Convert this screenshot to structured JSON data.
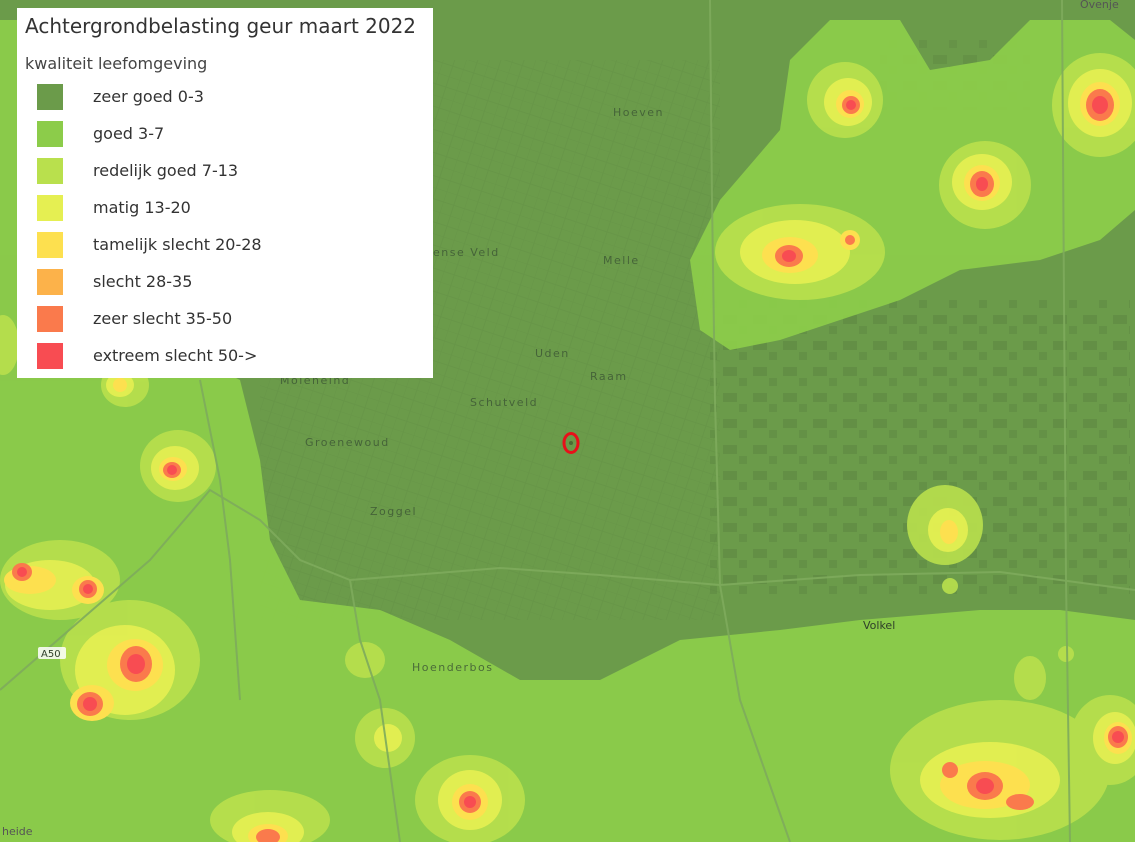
{
  "map": {
    "title": "Achtergrondbelasting geur maart 2022",
    "subtitle": "kwaliteit leefomgeving",
    "legend": [
      {
        "label": "zeer goed 0-3",
        "color": "#6b9b4a"
      },
      {
        "label": "goed 3-7",
        "color": "#8ccc4a"
      },
      {
        "label": "redelijk goed 7-13",
        "color": "#b9e04d"
      },
      {
        "label": "matig 13-20",
        "color": "#e5ef52"
      },
      {
        "label": "tamelijk slecht 20-28",
        "color": "#fde04f"
      },
      {
        "label": "slecht 28-35",
        "color": "#fcb24a"
      },
      {
        "label": "zeer slecht 35-50",
        "color": "#fa7a4c"
      },
      {
        "label": "extreem slecht 50->",
        "color": "#f84c52"
      }
    ],
    "place_labels": {
      "hoeven": "Hoeven",
      "velde": "ense Veld",
      "melle": "Melle",
      "uden": "Uden",
      "raam": "Raam",
      "schutveld": "Schutveld",
      "groenewoud": "Groenewoud",
      "zoggel": "Zoggel",
      "volkel": "Volkel",
      "hoenderbos": "Hoenderbos",
      "moleneind": "Moleneind",
      "ovenje": "Ovenje",
      "heide": "heide"
    },
    "road_labels": {
      "a50": "A50"
    },
    "colors": {
      "base": "#6b9b4a",
      "good": "#8ccc4a",
      "reasonable": "#b9e04d",
      "moderate": "#e5ef52",
      "fair_bad": "#fde04f",
      "bad": "#fcb24a",
      "very_bad": "#fa7a4c",
      "extreme": "#f84c52",
      "marker": "#e8101a"
    }
  }
}
